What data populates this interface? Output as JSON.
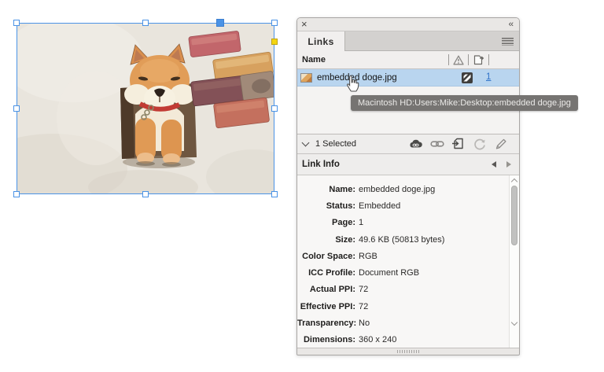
{
  "canvas": {
    "frame": {
      "selection_color": "#4b93e6",
      "corner_widget_color": "#f4d511",
      "artwork_description": "shiba inu dog leaning through hole in cream stucco wall with decorative bricks"
    }
  },
  "panel": {
    "titlebar": {
      "close": "×",
      "collapse": "‹‹"
    },
    "tab_label": "Links",
    "name_header": "Name",
    "row": {
      "filename": "embedded doge.jpg",
      "page_link": "1"
    },
    "selected_bar": {
      "count_label": "1 Selected"
    },
    "toolbar_icons": [
      "cc-libraries-icon",
      "relink-icon",
      "go-to-link-icon",
      "update-link-icon",
      "edit-original-icon"
    ],
    "link_info": {
      "title": "Link Info",
      "fields": [
        {
          "label": "Name:",
          "value": "embedded doge.jpg"
        },
        {
          "label": "Status:",
          "value": "Embedded"
        },
        {
          "label": "Page:",
          "value": "1"
        },
        {
          "label": "Size:",
          "value": "49.6 KB (50813 bytes)"
        },
        {
          "label": "Color Space:",
          "value": "RGB"
        },
        {
          "label": "ICC Profile:",
          "value": "Document RGB"
        },
        {
          "label": "Actual PPI:",
          "value": "72"
        },
        {
          "label": "Effective PPI:",
          "value": "72"
        },
        {
          "label": "Transparency:",
          "value": "No"
        },
        {
          "label": "Dimensions:",
          "value": "360 x 240"
        }
      ]
    }
  },
  "tooltip": {
    "text": "Macintosh HD:Users:Mike:Desktop:embedded doge.jpg"
  },
  "icons": {
    "close-icon": "×",
    "collapse-panel-icon": "‹‹",
    "panel-menu-icon": "hamburger-lines",
    "warning-icon": "triangle-exclamation",
    "page-column-icon": "page-with-arrow",
    "image-thumbnail-icon": "mini-photo",
    "embedded-status-icon": "dark-square-diagonal",
    "cc-libraries-icon": "cloud-link",
    "relink-icon": "chain",
    "go-to-link-icon": "page-with-arrow",
    "update-link-icon": "refresh-circle",
    "edit-original-icon": "pencil",
    "prev-link-icon": "left-triangle",
    "next-link-icon": "right-triangle",
    "disclosure-icon": "chevron-down",
    "scroll-up-icon": "chevron-up",
    "scroll-down-icon": "chevron-down",
    "hand-cursor": "pointer-hand"
  },
  "colors": {
    "row_highlight": "#b9d5ef",
    "link_blue": "#2f72c8",
    "selection_blue": "#4b93e6",
    "tooltip_gray": "#767472"
  }
}
